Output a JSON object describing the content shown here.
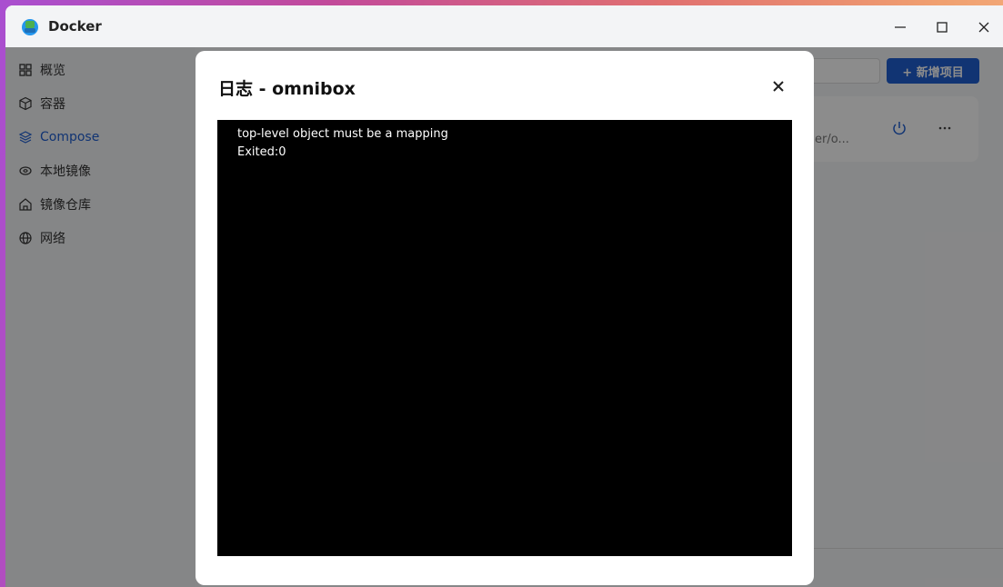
{
  "window": {
    "title": "Docker"
  },
  "sidebar": {
    "items": [
      {
        "label": "概览",
        "icon": "grid-icon"
      },
      {
        "label": "容器",
        "icon": "box-icon"
      },
      {
        "label": "Compose",
        "icon": "layers-icon",
        "active": true
      },
      {
        "label": "本地镜像",
        "icon": "disk-icon"
      },
      {
        "label": "镜像仓库",
        "icon": "home-icon"
      },
      {
        "label": "网络",
        "icon": "globe-icon"
      }
    ]
  },
  "main": {
    "add_button_label": "+ 新增项目",
    "card_path": "er/o..."
  },
  "modal": {
    "title": "日志 - omnibox",
    "log_lines": [
      "top-level object must be a mapping",
      "Exited:0"
    ]
  },
  "colors": {
    "accent": "#1f5fd1",
    "log_background": "#000000"
  }
}
